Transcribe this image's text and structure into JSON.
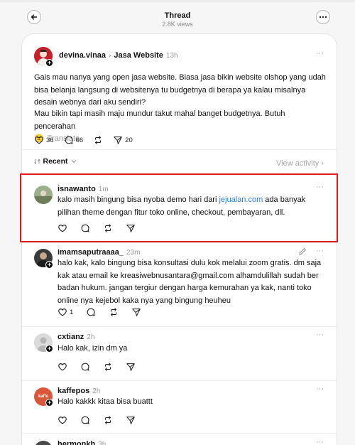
{
  "header": {
    "title": "Thread",
    "views": "2.8K views"
  },
  "post": {
    "username": "devina.vinaa",
    "breadcrumb": "Jasa Website",
    "time": "13h",
    "paragraph1": "Gais mau nanya yang open jasa website. Biasa jasa bikin website olshop yang udah bisa belanja langsung di websitenya tu budgetnya di berapa ya kalau misalnya desain webnya dari aku sendiri?",
    "paragraph2": "Mau bikin tapi masih maju mundur takut mahal banget budgetnya. Butuh pencerahan",
    "emoji": "🙂",
    "translate": "Translate",
    "likes": "36",
    "comments": "66",
    "shares": "20"
  },
  "sort": {
    "label": "Recent",
    "view_activity": "View activity"
  },
  "replies": [
    {
      "username": "isnawanto",
      "time": "1m",
      "text_before_link": "kalo masih bingung bisa nyoba demo hari dari ",
      "link": "jejualan.com",
      "text_after_link": " ada banyak pilihan theme dengan fitur toko online, checkout, pembayaran, dll.",
      "likes": ""
    },
    {
      "username": "imamsaputraaaa_",
      "time": "23m",
      "text": "halo kak, kalo bingung bisa konsultasi dulu kok melalui zoom gratis. dm saja kak atau email ke kreasiwebnusantara@gmail.com alhamdulillah sudah ber badan hukum. jangan tergiur dengan harga kemurahan ya kak, nanti toko online nya kejebol kaka nya yang bingung heuheu",
      "likes": "1"
    },
    {
      "username": "cxtianz",
      "time": "2h",
      "text": "Halo kak, izin dm ya",
      "likes": ""
    },
    {
      "username": "kaffepos",
      "time": "2h",
      "text": "Halo kakkk kitaa bisa buattt",
      "avatar_text": "kaffe",
      "likes": ""
    },
    {
      "username": "hermonkh",
      "time": "3h"
    }
  ],
  "colors": {
    "link": "#2b7de9",
    "highlight": "#e11c1c",
    "emoji": "#f5c033"
  }
}
